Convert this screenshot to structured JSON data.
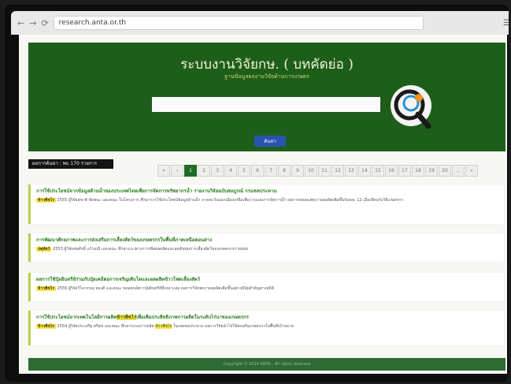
{
  "browser": {
    "url": "research.anta.or.th"
  },
  "banner": {
    "title": "ระบบงานวิจัยกษ. ( บทคัดย่อ )",
    "subtitle": "ฐานข้อมูลผลงานวิจัยด้านการเกษตร",
    "search_placeholder": "",
    "search_button": "ค้นหา",
    "colors": {
      "banner": "#1e5e1b",
      "title": "#f3f3d5",
      "button": "#2a53b0"
    }
  },
  "result_count": "ผลการค้นหา : พบ 170 รายการ",
  "pagination": {
    "prev": "«",
    "first": "1",
    "pages": [
      "2",
      "3",
      "4",
      "5",
      "6",
      "7",
      "8",
      "9",
      "10",
      "11",
      "12",
      "13",
      "14",
      "15",
      "16",
      "17",
      "18",
      "19",
      "20",
      "..."
    ],
    "next": "»",
    "last": "»"
  },
  "results": [
    {
      "title": "การใช้ประโยชน์จากข้อมูลด้านน้ำของประเทศไทยเพื่อการจัดการทรัพยากรน้ำ รายงานวิจัยฉบับสมบูรณ์ กรมชลประทาน",
      "category": "ข้าวพืชไร่",
      "meta_lead": "2555 ผู้วิจัยสุชาติ ชัยชนะ และคณะ ในโครงการ ",
      "meta_hl": "",
      "meta_tail": "ศึกษาการใช้ประโยชน์ข้อมูลด้านน้ำ ภาคตะวันออกเฉียงเหนือเพื่อวางแผนการจัดการน้ำ ผลการทดลองพบว่าผลผลิตเพิ่มขึ้นร้อยละ 12 เมื่อเทียบกับวิธีเกษตรกร"
    },
    {
      "title": "การพัฒนาศักยภาพและการส่งเสริมการเลี้ยงสัตว์ของเกษตรกรในพื้นที่ภาคเหนือตอนล่าง",
      "category": "ปศุสัตว์",
      "meta_lead": "2553 ผู้วิจัยสมศักดิ์ แก้วมณี และคณะ ",
      "meta_hl": "",
      "meta_tail": "ศึกษาแนวทางการเพิ่มผลผลิตและลดต้นทุนการเลี้ยงสัตว์ของเกษตรกรรายย่อย"
    },
    {
      "title": "ผลการใช้ปุ๋ยอินทรีย์ร่วมกับปุ๋ยเคมีต่อการเจริญเติบโตและผลผลิตข้าวโพดเลี้ยงสัตว์",
      "category": "ข้าวพืชไร่",
      "meta_lead": "2556 ผู้วิจัยวิไลวรรณ ทองดี และคณะ ",
      "meta_hl": "",
      "meta_tail": "ทดสอบอัตราปุ๋ยอินทรีย์ที่เหมาะสม ผลการวิจัยพบว่าผลผลิตเพิ่มขึ้นอย่างมีนัยสำคัญทางสถิติ"
    },
    {
      "title_lead": "การใช้ประโยชน์จากเทคโนโลยีการผลิต",
      "title_hl": "ข้าวพืชไร่",
      "title_tail": "เพื่อเพิ่มประสิทธิภาพการผลิตในระดับไร่นาของเกษตรกร",
      "category": "ข้าวพืชไร่",
      "meta_lead": "2554 ผู้วิจัยประเสริฐ ศรีสุข และคณะ ศึกษาระบบการผลิต ",
      "meta_hl": "ข้าวพืชไร่",
      "meta_tail": " ในเขตชลประทาน ผลการวิจัยนำไปใช้ส่งเสริมเกษตรกรในพื้นที่เป้าหมาย"
    }
  ],
  "footer": "Copyright © 2014 ANTA - All rights reserved"
}
